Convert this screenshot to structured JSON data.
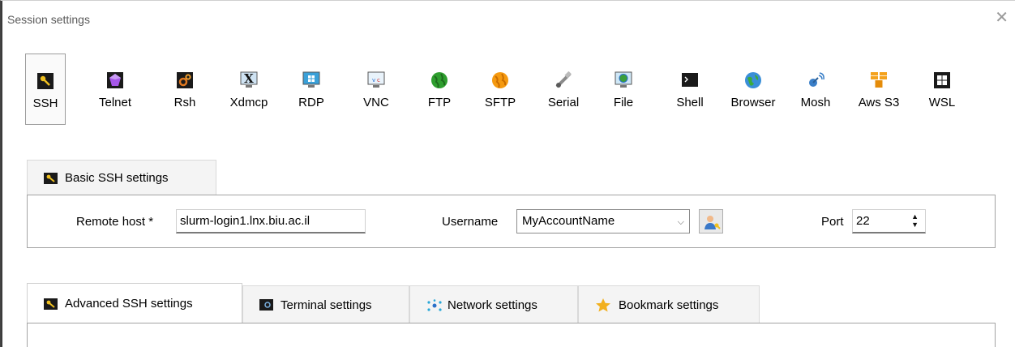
{
  "window": {
    "title": "Session settings",
    "close_glyph": "✕"
  },
  "session_types": [
    {
      "label": "SSH",
      "icon": "key-icon"
    },
    {
      "label": "Telnet",
      "icon": "purple-gem-icon"
    },
    {
      "label": "Rsh",
      "icon": "gears-icon"
    },
    {
      "label": "Xdmcp",
      "icon": "x-monitor-icon"
    },
    {
      "label": "RDP",
      "icon": "windows-monitor-icon"
    },
    {
      "label": "VNC",
      "icon": "vnc-monitor-icon"
    },
    {
      "label": "FTP",
      "icon": "green-globe-icon"
    },
    {
      "label": "SFTP",
      "icon": "orange-globe-icon"
    },
    {
      "label": "Serial",
      "icon": "satellite-icon"
    },
    {
      "label": "File",
      "icon": "file-monitor-icon"
    },
    {
      "label": "Shell",
      "icon": "terminal-icon"
    },
    {
      "label": "Browser",
      "icon": "earth-icon"
    },
    {
      "label": "Mosh",
      "icon": "antenna-icon"
    },
    {
      "label": "Aws S3",
      "icon": "aws-cubes-icon"
    },
    {
      "label": "WSL",
      "icon": "windows-tile-icon"
    }
  ],
  "selected_session": "SSH",
  "basic": {
    "tab_label": "Basic SSH settings",
    "remote_host_label": "Remote host *",
    "remote_host_value": "slurm-login1.lnx.biu.ac.il",
    "username_label": "Username",
    "username_value": "MyAccountName",
    "port_label": "Port",
    "port_value": "22"
  },
  "bottom_tabs": [
    {
      "label": "Advanced SSH settings",
      "icon": "key-icon",
      "active": true
    },
    {
      "label": "Terminal settings",
      "icon": "terminal-gear-icon",
      "active": false
    },
    {
      "label": "Network settings",
      "icon": "network-star-icon",
      "active": false
    },
    {
      "label": "Bookmark settings",
      "icon": "star-icon",
      "active": false
    }
  ],
  "colors": {
    "key_bg": "#1a1a1a",
    "key_fg": "#f0c020",
    "green_globe": "#2e9e2e",
    "orange_globe": "#f59a10",
    "monitor": "#3aa0d8",
    "aws": "#f4a21d",
    "star": "#f2b01e"
  }
}
